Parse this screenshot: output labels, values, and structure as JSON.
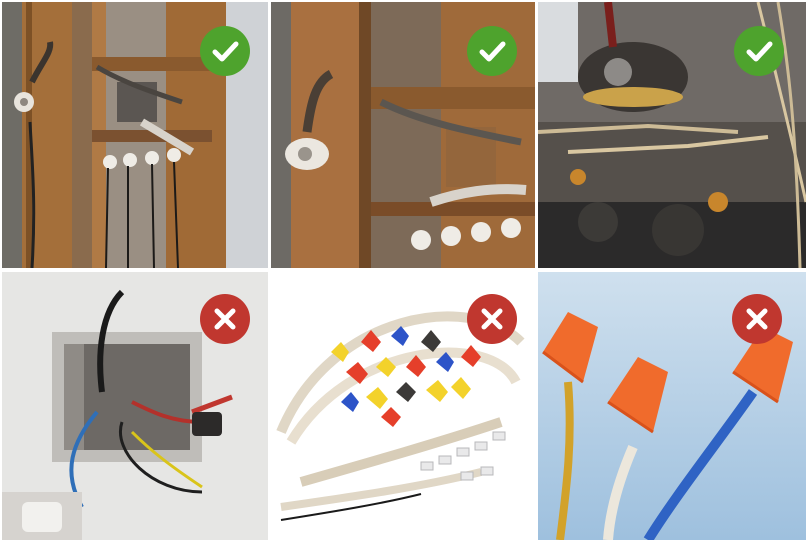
{
  "panels": [
    {
      "scene_icon": "knob-and-tube-wiring-wall-icon",
      "verdict": "approved",
      "badge_icon": "checkmark-icon",
      "badge_color": "#4ea32d"
    },
    {
      "scene_icon": "knob-and-tube-wiring-closeup-icon",
      "verdict": "approved",
      "badge_icon": "checkmark-icon",
      "badge_color": "#4ea32d"
    },
    {
      "scene_icon": "vintage-fuse-terminal-wiring-icon",
      "verdict": "approved",
      "badge_icon": "checkmark-icon",
      "badge_color": "#4ea32d"
    },
    {
      "scene_icon": "modern-junction-box-wiring-icon",
      "verdict": "rejected",
      "badge_icon": "x-mark-icon",
      "badge_color": "#c0372f"
    },
    {
      "scene_icon": "cable-and-wire-nuts-icon",
      "verdict": "rejected",
      "badge_icon": "x-mark-icon",
      "badge_color": "#c0372f"
    },
    {
      "scene_icon": "wire-nut-connectors-icon",
      "verdict": "rejected",
      "badge_icon": "x-mark-icon",
      "badge_color": "#c0372f"
    }
  ],
  "colors": {
    "approved": "#4ea32d",
    "rejected": "#c0372f",
    "background": "#ffffff"
  }
}
